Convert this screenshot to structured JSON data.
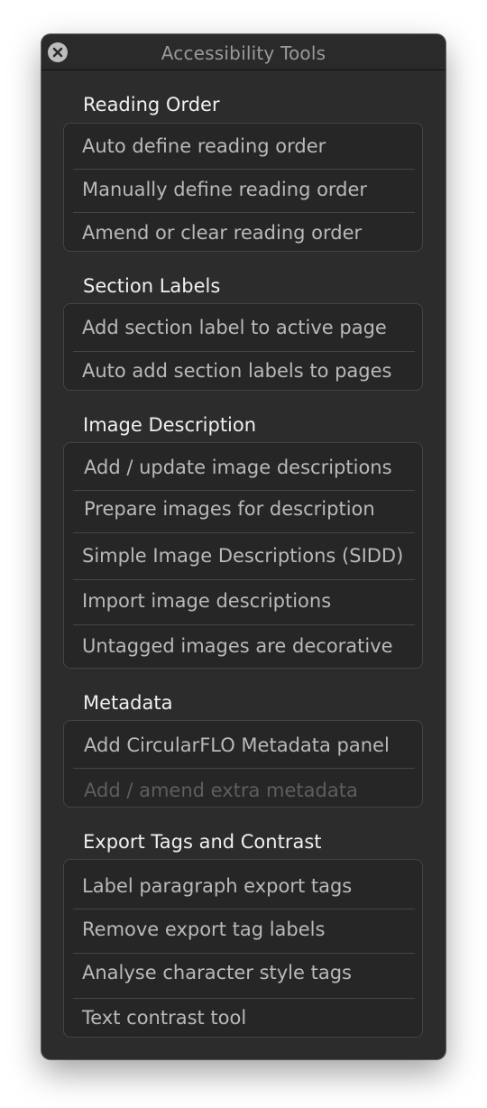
{
  "window": {
    "title": "Accessibility Tools"
  },
  "sections": [
    {
      "title": "Reading Order",
      "items": [
        {
          "label": "Auto define reading order",
          "enabled": true
        },
        {
          "label": "Manually define reading order",
          "enabled": true
        },
        {
          "label": "Amend or clear reading order",
          "enabled": true
        }
      ]
    },
    {
      "title": "Section Labels",
      "items": [
        {
          "label": "Add section label to active page",
          "enabled": true
        },
        {
          "label": "Auto add section labels to pages",
          "enabled": true
        }
      ]
    },
    {
      "title": "Image Description",
      "items": [
        {
          "label": "Add / update image descriptions",
          "enabled": true
        },
        {
          "label": "Prepare images for description",
          "enabled": true
        },
        {
          "label": "Simple Image Descriptions (SIDD)",
          "enabled": true
        },
        {
          "label": "Import image descriptions",
          "enabled": true
        },
        {
          "label": "Untagged images are decorative",
          "enabled": true
        }
      ]
    },
    {
      "title": "Metadata",
      "items": [
        {
          "label": "Add CircularFLO Metadata panel",
          "enabled": true
        },
        {
          "label": "Add / amend extra metadata",
          "enabled": false
        }
      ]
    },
    {
      "title": "Export Tags and Contrast",
      "items": [
        {
          "label": "Label paragraph export tags",
          "enabled": true
        },
        {
          "label": "Remove export tag labels",
          "enabled": true
        },
        {
          "label": "Analyse character style tags",
          "enabled": true
        },
        {
          "label": "Text contrast tool",
          "enabled": true
        }
      ]
    }
  ]
}
